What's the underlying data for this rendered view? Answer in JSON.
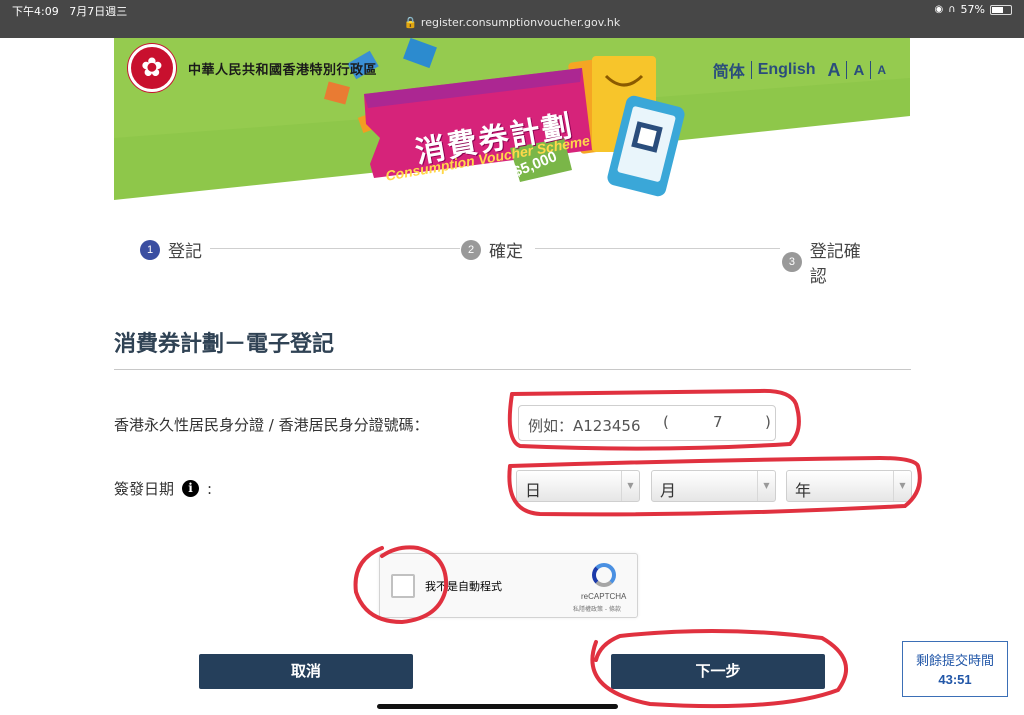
{
  "status_bar": {
    "time": "下午4:09",
    "date": "7月7日週三",
    "url": "register.consumptionvoucher.gov.hk",
    "battery": "57%"
  },
  "banner": {
    "gov_name": "中華人民共和國香港特別行政區",
    "lang_simplified": "简体",
    "lang_english": "English",
    "font_large": "A",
    "font_medium": "A",
    "font_small": "A",
    "title": "消費券計劃",
    "subtitle": "Consumption Voucher Scheme",
    "price": "$5,000"
  },
  "stepper": {
    "steps": [
      {
        "num": "1",
        "label": "登記"
      },
      {
        "num": "2",
        "label": "確定"
      },
      {
        "num": "3",
        "label": "登記確認"
      }
    ]
  },
  "form": {
    "section_title": "消費券計劃－電子登記",
    "hkid_label": "香港永久性居民身分證 / 香港居民身分證號碼：",
    "hkid_placeholder": "例如：A123456",
    "check_open": "(",
    "check_digit": "7",
    "check_close": ")",
    "date_label": "簽發日期",
    "date_colon": ":",
    "info_icon": "i",
    "day": "日",
    "month": "月",
    "year": "年"
  },
  "recaptcha": {
    "label": "我不是自動程式",
    "brand": "reCAPTCHA",
    "links": "私隱權政策 - 條款"
  },
  "buttons": {
    "cancel": "取消",
    "next": "下一步"
  },
  "timer": {
    "label": "剩餘提交時間",
    "value": "43:51"
  },
  "colors": {
    "banner_green": "#8ec74a",
    "primary_button": "#253f5b",
    "annotation_red": "#e0313f"
  }
}
